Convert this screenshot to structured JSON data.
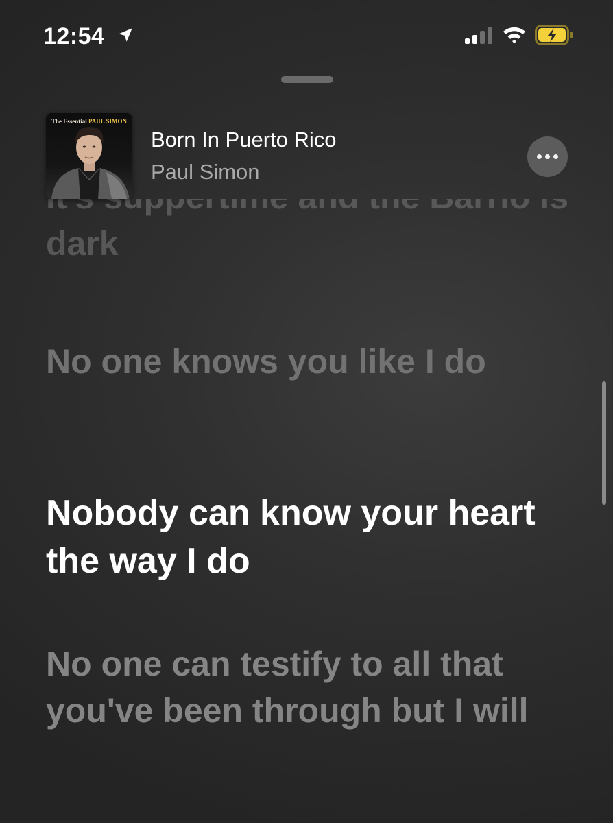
{
  "status_bar": {
    "time": "12:54",
    "icons": [
      "location-arrow-icon",
      "cellular-signal-icon",
      "wifi-icon",
      "battery-charging-icon"
    ],
    "battery_color": "#f4d03a"
  },
  "now_playing": {
    "album_art_text": "The Essential",
    "album_art_artist_text": "PAUL SIMON",
    "title": "Born In Puerto Rico",
    "artist": "Paul Simon",
    "more_icon": "ellipsis-icon"
  },
  "lyrics": {
    "lines": [
      "It's suppertime and the Barrio is dark",
      "No one knows you like I do",
      "Nobody can know your heart the way I do",
      "No one can testify to all that you've been through but I will"
    ],
    "active_index": 2
  }
}
